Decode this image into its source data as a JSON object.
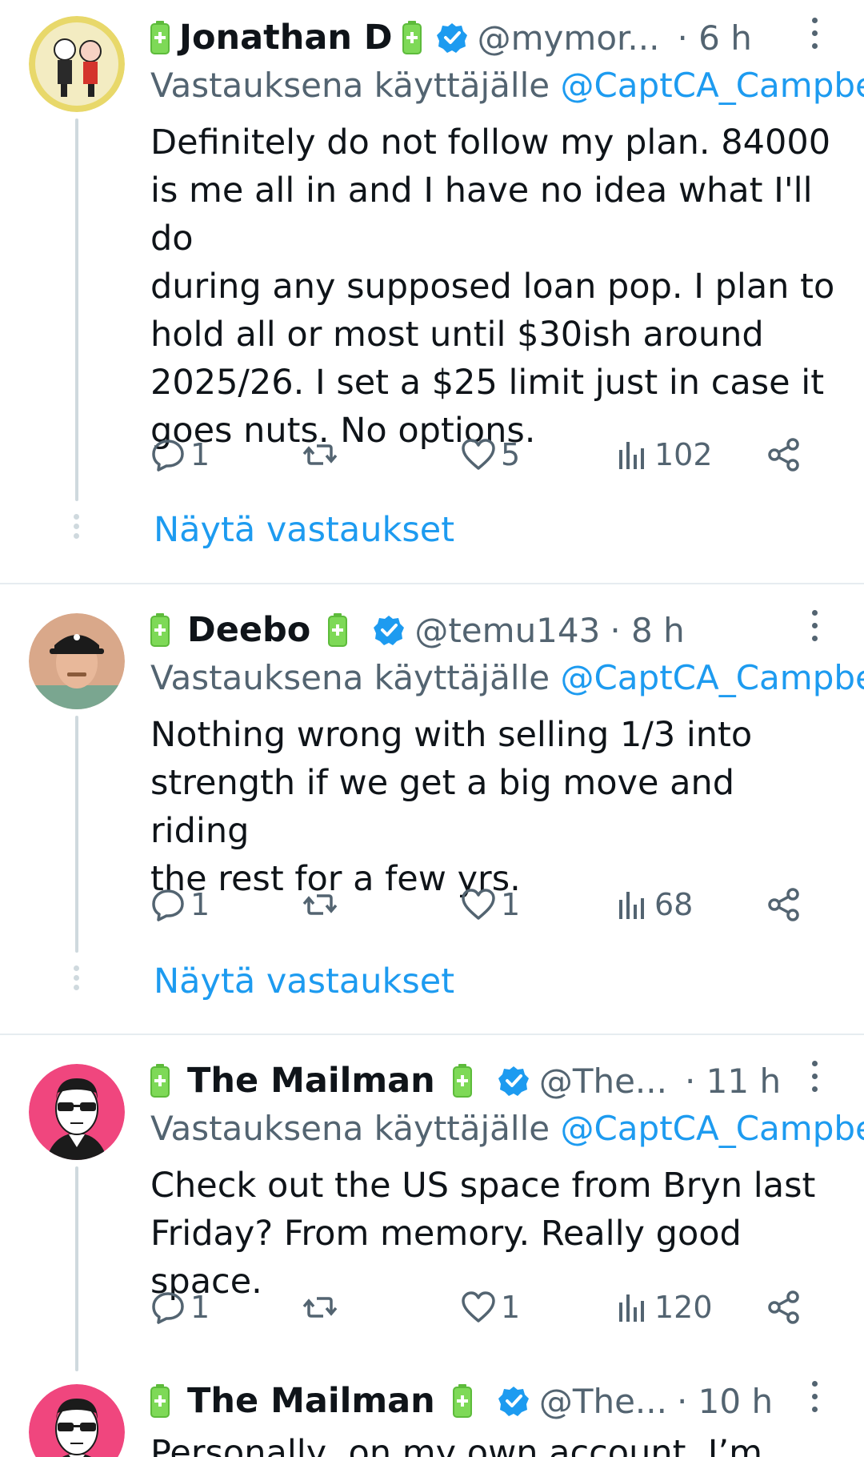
{
  "tweets": [
    {
      "name": "Jonathan D",
      "handle": "@mymor...",
      "time": "· 6 h",
      "reply_prefix": "Vastauksena käyttäjälle",
      "reply_mention": "@CaptCA_Campbell",
      "text": "Definitely do not follow my plan.  84000\nis me all in and I have no idea what I'll do\nduring any supposed loan pop.  I plan to\nhold all or most until $30ish around\n2025/26.  I set a $25 limit just in case it\ngoes nuts.  No options.",
      "replies": "1",
      "retweets": "",
      "likes": "5",
      "views": "102",
      "show_replies": "Näytä vastaukset"
    },
    {
      "name": "Deebo",
      "handle": "@temu143",
      "time": "· 8 h",
      "reply_prefix": "Vastauksena käyttäjälle",
      "reply_mention": "@CaptCA_Campbell",
      "text": "Nothing wrong with selling 1/3 into\nstrength if we get a big move and riding\nthe rest for a few yrs.",
      "replies": "1",
      "retweets": "",
      "likes": "1",
      "views": "68",
      "show_replies": "Näytä vastaukset"
    },
    {
      "name": "The Mailman",
      "handle": "@The...",
      "time": "· 11 h",
      "reply_prefix": "Vastauksena käyttäjälle",
      "reply_mention": "@CaptCA_Campbell",
      "text": "Check out the US space from Bryn last\nFriday? From memory. Really good space.",
      "replies": "1",
      "retweets": "",
      "likes": "1",
      "views": "120"
    },
    {
      "name": "The Mailman",
      "handle": "@The...",
      "time": "· 10 h",
      "text": "Personally, on my own account, I’m"
    }
  ],
  "colors": {
    "link": "#1d9bf0",
    "muted": "#536471",
    "verified": "#1d9bf0",
    "battery": "#7ed957"
  },
  "icons": [
    "reply-icon",
    "retweet-icon",
    "like-icon",
    "views-icon",
    "share-icon",
    "battery-icon",
    "verified-badge-icon",
    "more-options-icon"
  ]
}
